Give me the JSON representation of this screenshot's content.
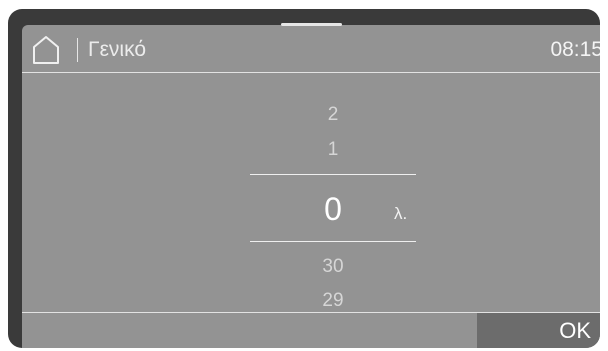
{
  "header": {
    "home_icon": "home-icon",
    "title": "Γενικό",
    "time": "08:15"
  },
  "picker": {
    "above": [
      "2",
      "1"
    ],
    "selected": "0",
    "unit": "λ.",
    "below": [
      "30",
      "29"
    ]
  },
  "footer": {
    "ok_label": "OK"
  },
  "colors": {
    "bezel": "#3a3a3a",
    "screen": "#939393",
    "ok_button": "#6c6c6c",
    "text": "#ffffff"
  }
}
